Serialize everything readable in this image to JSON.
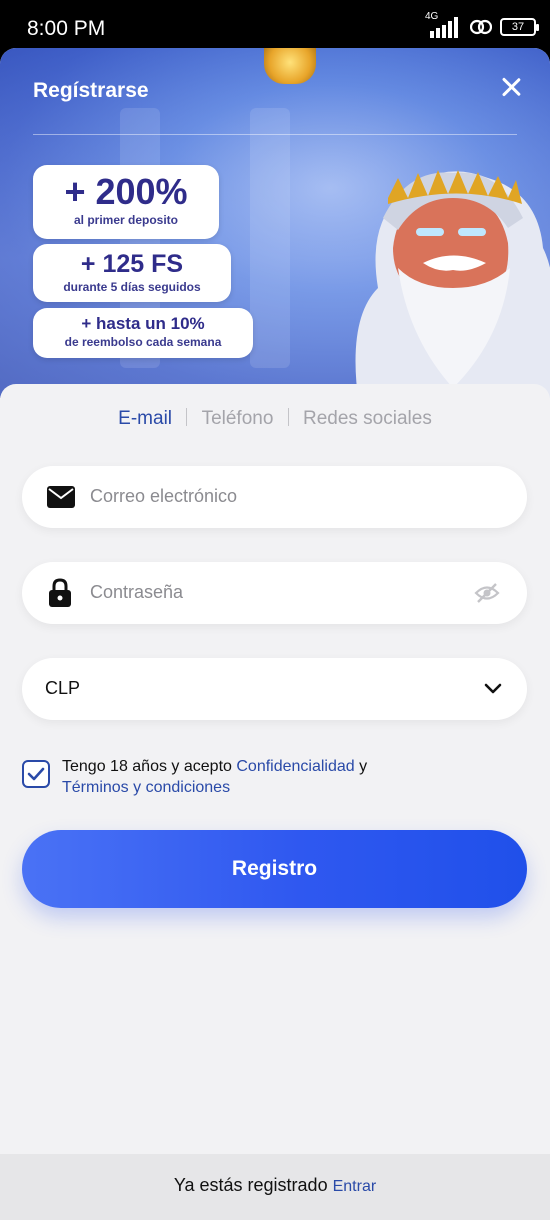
{
  "status_bar": {
    "time": "8:00 PM",
    "network": "4G",
    "battery": "37"
  },
  "banner": {
    "title": "Regístrarse",
    "promos": [
      {
        "big": "+ 200%",
        "small": "al primer deposito"
      },
      {
        "big": "+ 125 FS",
        "small": "durante 5 días seguidos"
      },
      {
        "big": "+ hasta un 10%",
        "small": "de reembolso cada semana"
      }
    ]
  },
  "tabs": [
    {
      "label": "E-mail",
      "active": true
    },
    {
      "label": "Teléfono",
      "active": false
    },
    {
      "label": "Redes sociales",
      "active": false
    }
  ],
  "form": {
    "email_placeholder": "Correo electrónico",
    "password_placeholder": "Contraseña",
    "currency_value": "CLP",
    "terms": {
      "checked": true,
      "prefix": "Tengo 18 años y acepto",
      "privacy_link": "Confidencialidad",
      "joiner": "y",
      "terms_link": "Términos y condiciones"
    },
    "submit_label": "Registro"
  },
  "footer": {
    "text": "Ya estás registrado",
    "login_link": "Entrar"
  },
  "colors": {
    "accent": "#2a4aa8",
    "button": "#2f58f0",
    "banner": "#4a6fd6"
  },
  "icons": [
    "close-icon",
    "mail-icon",
    "lock-icon",
    "eye-off-icon",
    "chevron-down-icon",
    "check-icon"
  ]
}
